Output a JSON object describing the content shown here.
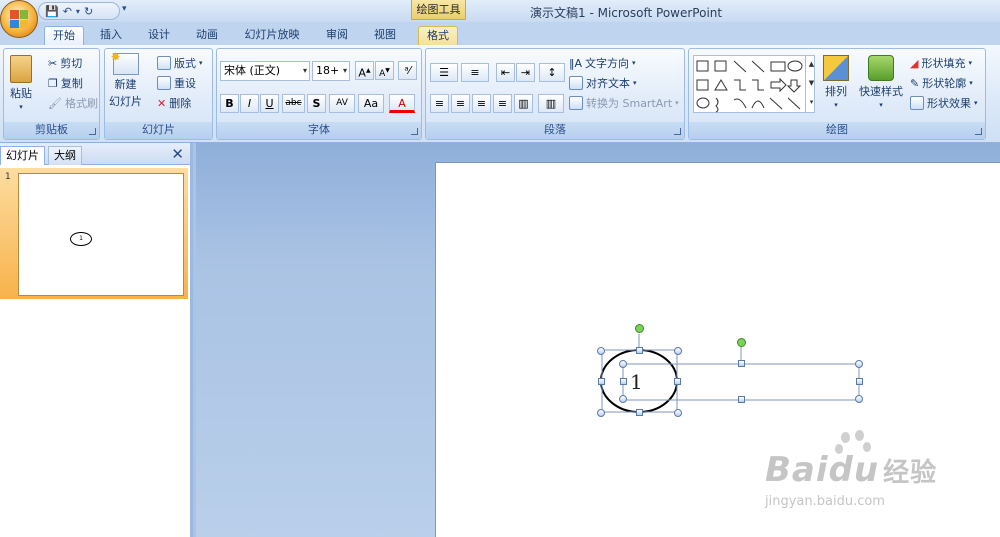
{
  "window": {
    "title": "演示文稿1 - Microsoft PowerPoint",
    "context_tool": "绘图工具"
  },
  "quick_access": {
    "more": "▾"
  },
  "tabs": [
    "开始",
    "插入",
    "设计",
    "动画",
    "幻灯片放映",
    "审阅",
    "视图",
    "格式"
  ],
  "active_tab": "开始",
  "clipboard": {
    "paste": "粘贴",
    "cut": "剪切",
    "copy": "复制",
    "format_painter": "格式刷",
    "title": "剪贴板"
  },
  "slides_group": {
    "new_slide": "新建",
    "new_slide2": "幻灯片",
    "layout": "版式",
    "reset": "重设",
    "delete": "删除",
    "title": "幻灯片"
  },
  "font": {
    "name": "宋体 (正文)",
    "size": "18+",
    "bold": "B",
    "italic": "I",
    "underline": "U",
    "strike": "abc",
    "shadow": "S",
    "spacing": "AV",
    "case": "Aa",
    "color": "A",
    "title": "字体"
  },
  "paragraph": {
    "text_direction": "文字方向",
    "align_text": "对齐文本",
    "convert_smartart": "转换为 SmartArt",
    "title": "段落"
  },
  "drawing": {
    "arrange": "排列",
    "quick_styles": "快速样式",
    "shape_fill": "形状填充",
    "shape_outline": "形状轮廓",
    "shape_effects": "形状效果",
    "title": "绘图"
  },
  "left_pane": {
    "tab_slides": "幻灯片",
    "tab_outline": "大纲",
    "close": "✕",
    "slide_number": "1",
    "thumb_text": "1"
  },
  "slide": {
    "shape_text": "1"
  },
  "watermark": {
    "brand": "Bai",
    "brand2": "du",
    "cn": "经验",
    "url": "jingyan.baidu.com"
  },
  "colors": {
    "accent": "#15428b",
    "ribbon": "#dbe8f8",
    "selected_thumb": "#f7b24b"
  }
}
